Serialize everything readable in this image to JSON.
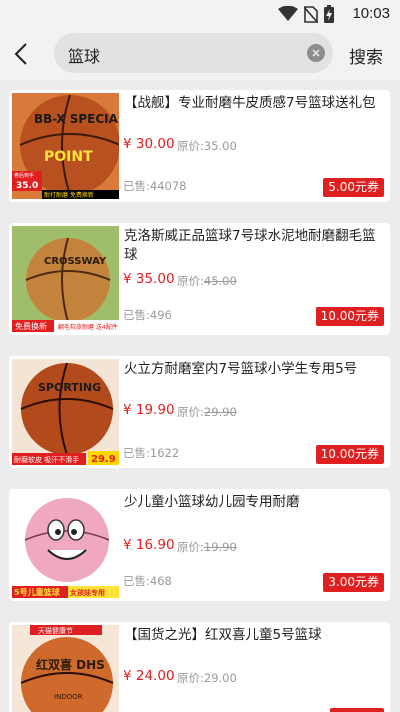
{
  "status": {
    "time": "10:03"
  },
  "search": {
    "query": "篮球",
    "button_label": "搜索"
  },
  "colors": {
    "accent": "#e02020",
    "muted": "#9a9a9a",
    "background": "#ececec"
  },
  "products": [
    {
      "title": "【战舰】专业耐磨牛皮质感7号篮球送礼包",
      "price": "¥ 30.00",
      "original_price_label": "原价:",
      "original_price": "35.00",
      "original_strike": false,
      "sold": "已售:44078",
      "coupon": "5.00元券",
      "image_brand": "BB-X SPECIAL",
      "image_logo": "POINT",
      "image_badge_top": "券后到手",
      "image_badge_price": "35.0",
      "image_footer": "耐打耐磨 免费换新",
      "image_footer_right": "7号标准"
    },
    {
      "title": "克洛斯威正品篮球7号球水泥地耐磨翻毛篮球",
      "price": "¥ 35.00",
      "original_price_label": "原价:",
      "original_price": "45.00",
      "original_strike": true,
      "sold": "已售:496",
      "coupon": "10.00元券",
      "image_brand": "CROSSWAY",
      "image_footer_left": "免费换新",
      "image_footer_right": "翻毛软皮耐磨 送4配件"
    },
    {
      "title": "火立方耐磨室内7号篮球小学生专用5号",
      "price": "¥ 19.90",
      "original_price_label": "原价:",
      "original_price": "29.90",
      "original_strike": true,
      "sold": "已售:1622",
      "coupon": "10.00元券",
      "image_brand": "SPORTING",
      "image_footer_left": "耐磨软皮 吸汗不滑手",
      "image_footer_right": "29.9"
    },
    {
      "title": "少儿童小篮球幼儿园专用耐磨",
      "price": "¥ 16.90",
      "original_price_label": "原价:",
      "original_price": "19.90",
      "original_strike": true,
      "sold": "已售:468",
      "coupon": "3.00元券",
      "image_footer_left": "5号儿童篮球",
      "image_footer_right": "女孩娃专用"
    },
    {
      "title": "【国货之光】红双喜儿童5号篮球",
      "price": "¥ 24.00",
      "original_price_label": "原价:",
      "original_price": "29.00",
      "original_strike": false,
      "sold": "",
      "coupon": "",
      "image_banner": "天猫健康节",
      "image_brand": "红双喜 DHS",
      "image_sub": "INDOOR"
    }
  ]
}
